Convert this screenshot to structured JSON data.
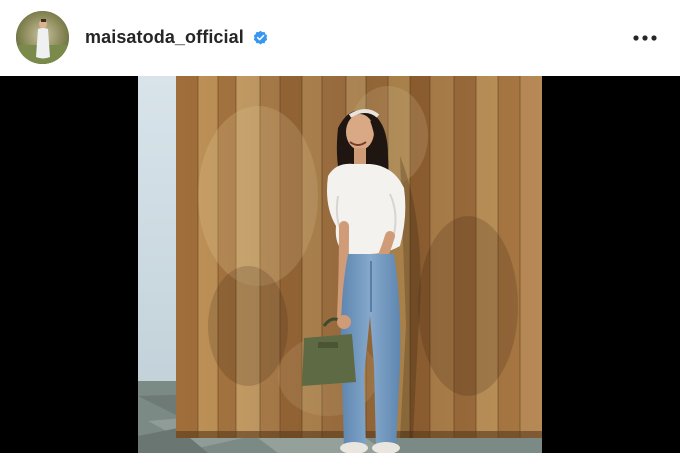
{
  "post": {
    "username": "maisatoda_official",
    "verified": true,
    "more_options_icon": "more-horizontal-icon",
    "verified_icon": "verified-badge-icon"
  },
  "colors": {
    "verified_blue": "#3897f0",
    "text": "#262626",
    "letterbox": "#000000",
    "wood_light": "#c99a5c",
    "wood_dark": "#8a5a2c"
  }
}
